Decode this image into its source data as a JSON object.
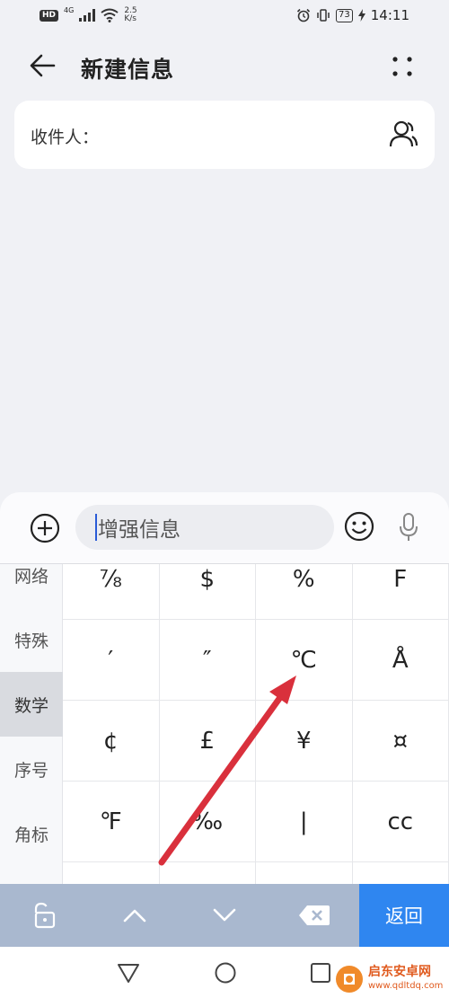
{
  "status_bar": {
    "hd": "HD",
    "signal_label": "4G",
    "speed_value": "2.5",
    "speed_unit": "K/s",
    "battery": "73",
    "time": "14:11"
  },
  "header": {
    "title": "新建信息"
  },
  "recipient": {
    "label": "收件人："
  },
  "compose": {
    "placeholder": "增强信息"
  },
  "keyboard": {
    "categories": [
      {
        "label": "网络",
        "active": false
      },
      {
        "label": "特殊",
        "active": false
      },
      {
        "label": "数学",
        "active": true
      },
      {
        "label": "序号",
        "active": false
      },
      {
        "label": "角标",
        "active": false
      }
    ],
    "keys": [
      [
        "⅞",
        "$",
        "%",
        "F"
      ],
      [
        "′",
        "″",
        "℃",
        "Å"
      ],
      [
        "¢",
        "£",
        "¥",
        "¤"
      ],
      [
        "℉",
        "‰",
        "|",
        "cc"
      ]
    ]
  },
  "action_bar": {
    "return_label": "返回"
  },
  "watermark": {
    "name": "启东安卓网",
    "url": "www.qdltdq.com"
  },
  "colors": {
    "accent": "#2f86f0",
    "action_bar": "#a9b8cf",
    "arrow": "#d9303c"
  }
}
